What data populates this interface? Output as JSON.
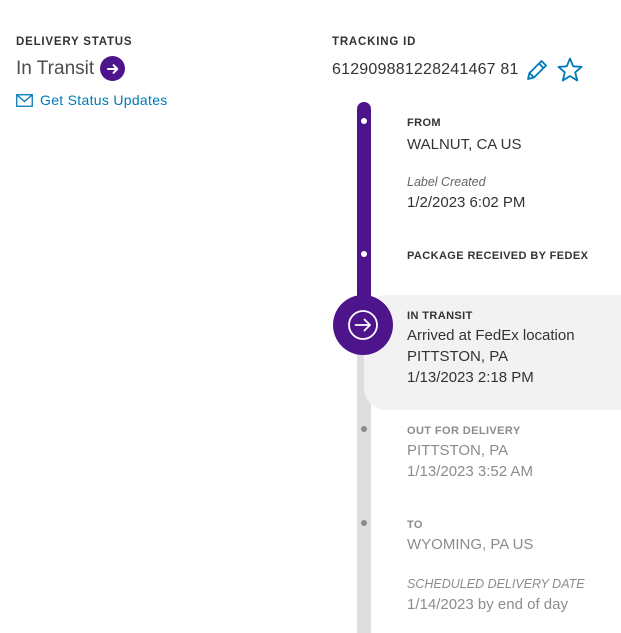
{
  "delivery_status": {
    "heading": "DELIVERY STATUS",
    "value": "In Transit",
    "status_icon": "arrow-right-circle-icon",
    "updates_icon": "envelope-icon",
    "updates_label": "Get Status Updates"
  },
  "tracking": {
    "heading": "TRACKING ID",
    "id": "612909881228241467 81",
    "edit_icon": "pencil-icon",
    "watch_icon": "star-icon"
  },
  "colors": {
    "brand_purple": "#4d148c",
    "link_blue": "#007ab7",
    "rail_grey": "#dedede",
    "highlight_bg": "#f2f2f2"
  },
  "timeline": {
    "from": {
      "title": "FROM",
      "location": "WALNUT, CA US"
    },
    "label_created": {
      "title": "Label Created",
      "datetime": "1/2/2023 6:02 PM"
    },
    "received": {
      "title": "PACKAGE RECEIVED BY FEDEX"
    },
    "in_transit": {
      "title": "IN TRANSIT",
      "detail": "Arrived at FedEx location",
      "location": "PITTSTON, PA",
      "datetime": "1/13/2023 2:18 PM",
      "icon": "arrow-right-circle-icon"
    },
    "out_for_delivery": {
      "title": "OUT FOR DELIVERY",
      "location": "PITTSTON, PA",
      "datetime": "1/13/2023 3:52 AM"
    },
    "to": {
      "title": "TO",
      "location": "WYOMING, PA US"
    },
    "scheduled": {
      "title": "SCHEDULED DELIVERY DATE",
      "datetime": "1/14/2023 by end of day"
    }
  }
}
